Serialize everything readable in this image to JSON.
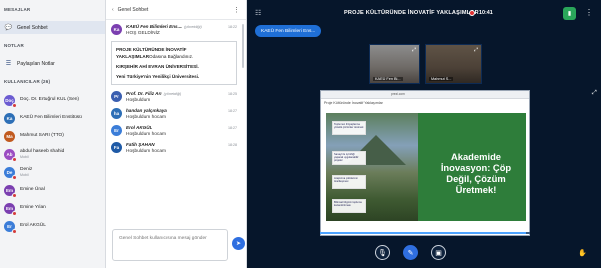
{
  "sidebar": {
    "messages_header": "MESAJLAR",
    "public_chat": "Genel Sohbet",
    "notes_header": "NOTLAR",
    "shared_notes": "Paylaşılan Notlar",
    "users_header": "KULLANICILAR (26)",
    "users": [
      {
        "initials": "Doç",
        "name": "Doç. Dr. Ertuğrul KUL (Sen)",
        "role": "",
        "color": "#6b5bd1",
        "muted": true
      },
      {
        "initials": "Ka",
        "name": "KAEÜ Fen Bilimleri Enstitüsü",
        "role": "",
        "color": "#2d6fb6",
        "muted": false
      },
      {
        "initials": "Ma",
        "name": "Mahmut SARI (TTO)",
        "role": "",
        "color": "#c15a1f",
        "muted": false
      },
      {
        "initials": "Ab",
        "name": "abdul haseeb shahid",
        "role": "Mobil",
        "color": "#9b4cc2",
        "muted": true
      },
      {
        "initials": "De",
        "name": "Deniz",
        "role": "Mobil",
        "color": "#3b7dd8",
        "muted": true
      },
      {
        "initials": "Em",
        "name": "Emine Ünal",
        "role": "",
        "color": "#7b3fb0",
        "muted": true
      },
      {
        "initials": "Em",
        "name": "Emine Yılan",
        "role": "",
        "color": "#7b3fb0",
        "muted": true
      },
      {
        "initials": "Er",
        "name": "Erol AKGÜL",
        "role": "",
        "color": "#3b7dd8",
        "muted": true
      }
    ]
  },
  "chat": {
    "title": "Genel Sohbet",
    "messages": [
      {
        "initials": "Ka",
        "name": "KAEÜ Fen Bilimleri Ens....",
        "role": "(yönetdiği)",
        "time": "18:22",
        "text": "HOŞ GELDİNİZ",
        "color": "#7b3fb0"
      },
      {
        "initials": "Pr",
        "name": "Prof. Dr. Filiz Arı",
        "role": "(yönetdiği)",
        "time": "18:25",
        "text": "Hoşbuldum",
        "color": "#3b5fb0"
      },
      {
        "initials": "ha",
        "name": "handan yalçınkaya",
        "role": "",
        "time": "18:27",
        "text": "Hoşbuldum hocam",
        "color": "#2d6fb6"
      },
      {
        "initials": "Er",
        "name": "Erol AKGÜL",
        "role": "",
        "time": "18:27",
        "text": "Hoşbuldum hocam",
        "color": "#3b7dd8"
      },
      {
        "initials": "Fa",
        "name": "Fatih ŞAHAN",
        "role": "",
        "time": "18:28",
        "text": "Hoşbuldum hocam",
        "color": "#1f5aa6"
      }
    ],
    "notice": {
      "bold": "PROJE KÜLTÜRÜNDE İNOVATİF YAKLAŞIMLAR",
      "after": "Odasına Bağlandınız.",
      "line2": "KIRŞEHİR AHİ EVRAN ÜNİVERSİTESİ.",
      "line3": "Yeni Türkiye'nin Yenilikçi Üniversitesi."
    },
    "compose_placeholder": "Genel Sohbet kullanıcısına mesaj gönder"
  },
  "stage": {
    "title": "PROJE KÜLTÜRÜNDE İNOVATİF YAKLAŞIMLAR",
    "record_time": "10:41",
    "presenter": "KAEÜ Fen Bilimleri Ens...",
    "cams": [
      {
        "label": "KAEÜ Fen Bi..."
      },
      {
        "label": "Mahmut S..."
      }
    ],
    "slide": {
      "window_title": "prezi.com",
      "bar_text": "Proje Kültüründe İnovatif Yaklaşımlar",
      "headline": "Akademide İnovasyon: Çöp Değil, Çözüm Üretmek!",
      "boxes": [
        "Toplumun ihtiyaçlarına yönelik çözümler üretmek",
        "Sanayi ile iş birliği yaparak uygulanabilir projeler",
        "Araştırma çıktılarının ticarileşmesi",
        "Bilimsel bilginin topluma kazandırılması"
      ],
      "progress": 0.98
    }
  },
  "icons": {
    "back": "‹",
    "more": "⋮",
    "send": "➤",
    "users": "☷",
    "conn": "▮",
    "options": "⋮",
    "mic": "🎙",
    "share": "✎",
    "cam": "▣",
    "raise": "✋",
    "fullscreen": "⤢",
    "chat": "💬",
    "notes": "☰"
  }
}
